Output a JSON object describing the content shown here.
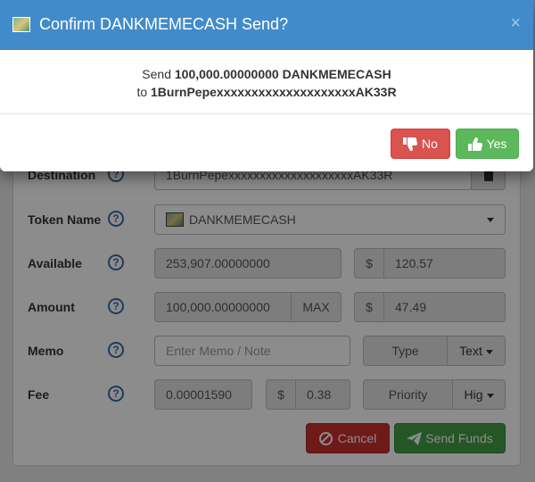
{
  "modal": {
    "title": "Confirm DANKMEMECASH Send?",
    "close": "×",
    "line1_prefix": "Send ",
    "line1_amount": "100,000.00000000 DANKMEMECASH",
    "line2_prefix": "to ",
    "line2_address": "1BurnPepexxxxxxxxxxxxxxxxxxxxAK33R",
    "no_label": "No",
    "yes_label": "Yes",
    "colors": {
      "header": "#428bca",
      "no": "#d9534f",
      "yes": "#5cb85c"
    }
  },
  "form": {
    "destination": {
      "label": "Destination",
      "value": "1BurnPepexxxxxxxxxxxxxxxxxxxxAK33R"
    },
    "token": {
      "label": "Token Name",
      "value": "DANKMEMECASH"
    },
    "available": {
      "label": "Available",
      "value": "253,907.00000000",
      "currency_symbol": "$",
      "usd": "120.57"
    },
    "amount": {
      "label": "Amount",
      "value": "100,000.00000000",
      "max_label": "MAX",
      "currency_symbol": "$",
      "usd": "47.49"
    },
    "memo": {
      "label": "Memo",
      "placeholder": "Enter Memo / Note",
      "type_label": "Type",
      "type_value": "Text"
    },
    "fee": {
      "label": "Fee",
      "value": "0.00001590",
      "currency_symbol": "$",
      "usd": "0.38",
      "priority_label": "Priority",
      "priority_value": "Hig"
    },
    "help_glyph": "?",
    "cancel_label": "Cancel",
    "send_label": "Send Funds"
  }
}
